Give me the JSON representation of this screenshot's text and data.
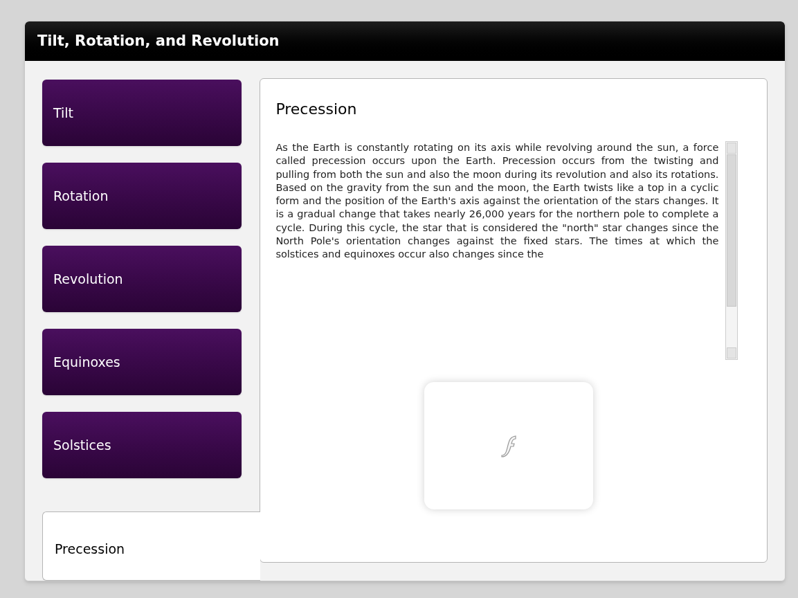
{
  "window": {
    "title": "Tilt, Rotation, and Revolution"
  },
  "tabs": [
    {
      "label": "Tilt",
      "selected": false
    },
    {
      "label": "Rotation",
      "selected": false
    },
    {
      "label": "Revolution",
      "selected": false
    },
    {
      "label": "Equinoxes",
      "selected": false
    },
    {
      "label": "Solstices",
      "selected": false
    },
    {
      "label": "Precession",
      "selected": true
    }
  ],
  "content": {
    "heading": "Precession",
    "body": "As the Earth is constantly rotating on its axis while revolving around the sun, a force called precession occurs upon the Earth. Precession occurs from the twisting and pulling from both the sun and also the moon during its revolution and also its rotations. Based on the gravity from the sun and the moon, the Earth twists like a top in a cyclic form and the position of the Earth's axis against the orientation of the stars changes. It is a gradual change that takes nearly 26,000 years for the northern pole to complete a cycle. During this cycle, the star that is considered the \"north\" star changes since the North Pole's orientation changes against the fixed stars. The times at which the solstices and equinoxes occur also changes since the"
  }
}
